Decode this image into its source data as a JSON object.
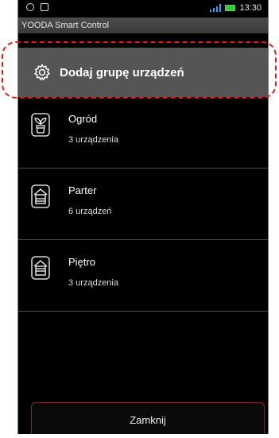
{
  "status_bar": {
    "time": "13:30",
    "accent": "#3aa0ff",
    "battery_color": "#33cc33"
  },
  "app": {
    "title": "YOODA Smart Control"
  },
  "add_group": {
    "label": "Dodaj grupę urządzeń",
    "icon": "gear-icon"
  },
  "groups": [
    {
      "name": "Ogród",
      "count": "3 urządzenia",
      "icon": "garden-plant-icon"
    },
    {
      "name": "Parter",
      "count": "6 urządzeń",
      "icon": "house-icon"
    },
    {
      "name": "Piętro",
      "count": "3 urządzenia",
      "icon": "house-icon"
    }
  ],
  "close_button": {
    "label": "Zamknij"
  },
  "callout_color": "#e41b1b"
}
